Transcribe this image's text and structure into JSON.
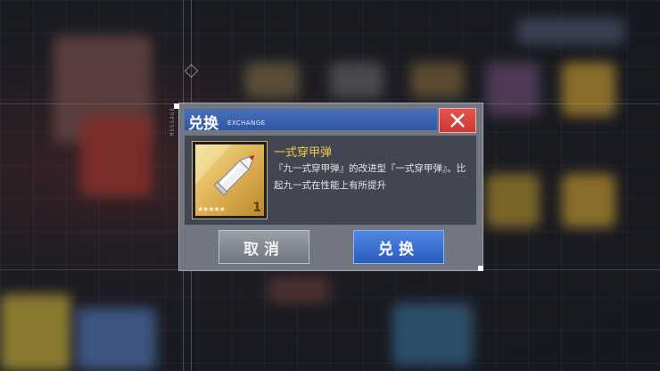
{
  "dialog": {
    "title": "兑换",
    "title_sub": "EXCHANGE",
    "close_icon": "close-icon",
    "item": {
      "name": "一式穿甲弹",
      "quantity": "1",
      "stars": "★★★★★",
      "description": "『九一式穿甲弹』的改进型『一式穿甲弹』。比起九一式在性能上有所提升",
      "icon": "armor-piercing-shell-icon"
    },
    "buttons": {
      "cancel": "取消",
      "confirm": "兑换"
    }
  },
  "background": {
    "side_label": "MESSAGE"
  },
  "colors": {
    "title_bar": "#2f58a6",
    "close": "#c93832",
    "item_name": "#f2c94c",
    "confirm": "#2a5cc0"
  }
}
